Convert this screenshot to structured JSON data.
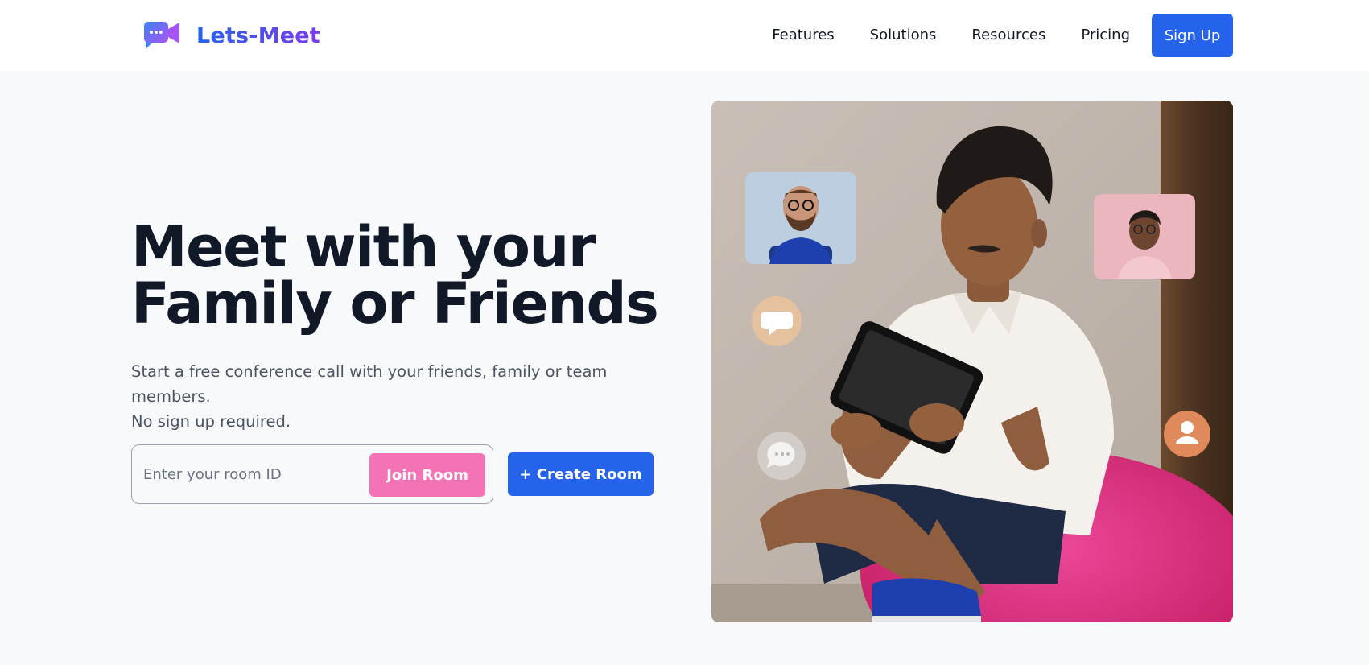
{
  "brand": {
    "name": "Lets-Meet",
    "logo_icon": "video-chat-icon"
  },
  "nav": {
    "links": [
      "Features",
      "Solutions",
      "Resources",
      "Pricing"
    ],
    "signup_label": "Sign Up"
  },
  "hero": {
    "title_line1": "Meet with your",
    "title_line2": "Family or Friends",
    "subtitle_line1": "Start a free conference call with your friends, family or team members.",
    "subtitle_line2": "No sign up required.",
    "room_input_placeholder": "Enter your room ID",
    "room_input_value": "",
    "join_label": "Join Room",
    "create_label": "+ Create Room"
  },
  "illustration": {
    "icons": [
      "avatar-bearded-man",
      "avatar-young-man",
      "chat-bubble-icon",
      "chat-dots-icon",
      "user-icon"
    ]
  },
  "colors": {
    "primary": "#2563eb",
    "accent_pink": "#f472b6",
    "brand_purple": "#7c3aed",
    "text_dark": "#111827",
    "text_muted": "#4b5563",
    "background": "#f8f9fb"
  }
}
